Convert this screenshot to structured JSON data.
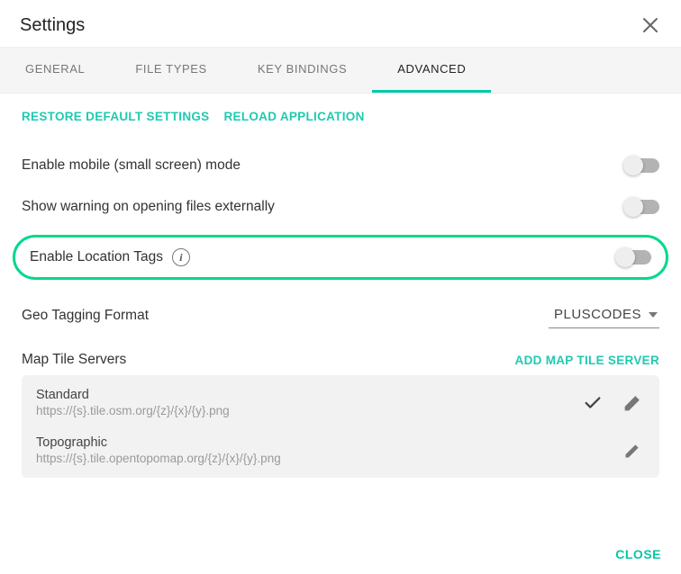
{
  "header": {
    "title": "Settings"
  },
  "tabs": [
    {
      "label": "GENERAL"
    },
    {
      "label": "FILE TYPES"
    },
    {
      "label": "KEY BINDINGS"
    },
    {
      "label": "ADVANCED"
    }
  ],
  "active_tab_index": 3,
  "top_links": {
    "restore": "RESTORE DEFAULT SETTINGS",
    "reload": "RELOAD APPLICATION"
  },
  "settings": {
    "mobile_mode": {
      "label": "Enable mobile (small screen) mode",
      "value": false
    },
    "external_warning": {
      "label": "Show warning on opening files externally",
      "value": false
    },
    "location_tags": {
      "label": "Enable Location Tags",
      "value": false
    }
  },
  "geo_format": {
    "label": "Geo Tagging Format",
    "value": "PLUSCODES"
  },
  "map_tile_servers": {
    "label": "Map Tile Servers",
    "add_label": "ADD MAP TILE SERVER",
    "items": [
      {
        "name": "Standard",
        "url": "https://{s}.tile.osm.org/{z}/{x}/{y}.png",
        "selected": true
      },
      {
        "name": "Topographic",
        "url": "https://{s}.tile.opentopomap.org/{z}/{x}/{y}.png",
        "selected": false
      }
    ]
  },
  "footer": {
    "close": "CLOSE"
  }
}
